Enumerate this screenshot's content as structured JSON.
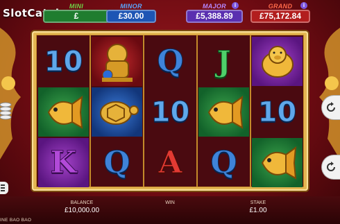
{
  "watermark": "SlotCatalog.com",
  "jackpots": [
    {
      "label": "MINI",
      "value": "£",
      "label_color": "#6ed246",
      "box_color": "#1f7d2f"
    },
    {
      "label": "MINOR",
      "value": "£30.00",
      "label_color": "#5aa7ff",
      "box_color": "#1d55b4"
    },
    {
      "label": "MAJOR",
      "value": "£5,388.89",
      "label_color": "#b687ff",
      "box_color": "#5a2fb0",
      "info": "i"
    },
    {
      "label": "GRAND",
      "value": "£75,172.84",
      "label_color": "#ff6a4a",
      "box_color": "#b21e1e",
      "info": "i"
    }
  ],
  "reels": [
    [
      {
        "type": "text",
        "text": "10",
        "style": "num"
      },
      {
        "type": "fish",
        "bg": "green"
      },
      {
        "type": "text",
        "text": "K",
        "style": "let-k",
        "bg": "purple"
      }
    ],
    [
      {
        "type": "lion",
        "bg": "red"
      },
      {
        "type": "turtle",
        "bg": "blue"
      },
      {
        "type": "text",
        "text": "Q",
        "style": "let-q"
      }
    ],
    [
      {
        "type": "text",
        "text": "Q",
        "style": "let-q"
      },
      {
        "type": "text",
        "text": "10",
        "style": "num"
      },
      {
        "type": "text",
        "text": "A",
        "style": "let-a"
      }
    ],
    [
      {
        "type": "text",
        "text": "J",
        "style": "let-j"
      },
      {
        "type": "fish",
        "bg": "green"
      },
      {
        "type": "text",
        "text": "Q",
        "style": "let-q"
      }
    ],
    [
      {
        "type": "pig",
        "bg": "purple"
      },
      {
        "type": "text",
        "text": "10",
        "style": "num"
      },
      {
        "type": "fish",
        "bg": "green"
      }
    ]
  ],
  "bottom": {
    "balance_label": "BALANCE",
    "balance_value": "£10,000.00",
    "win_label": "WIN",
    "stake_label": "STAKE",
    "stake_value": "£1.00",
    "game_name": "INE BAO BAO"
  },
  "icons": [
    "spin-icon",
    "autoplay-icon",
    "settings-icon",
    "menu-icon",
    "coins-icon"
  ],
  "colors": {
    "frame": "#e3b652",
    "background": "#6e0b12"
  }
}
